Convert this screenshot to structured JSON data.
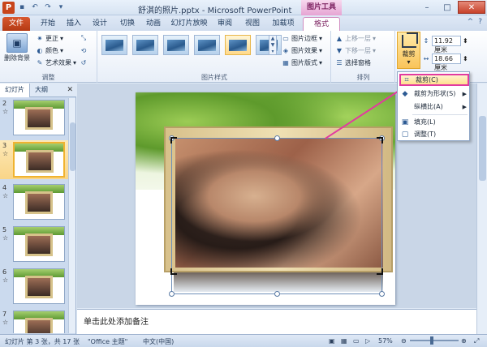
{
  "titlebar": {
    "title": "舒淇的照片.pptx - Microsoft PowerPoint",
    "context_group": "图片工具",
    "app_icon": "P",
    "qat": [
      "save-icon",
      "undo-icon",
      "redo-icon",
      "dropdown-icon"
    ],
    "controls": {
      "minimize": "–",
      "maximize": "□",
      "close": "✕"
    }
  },
  "tabs": {
    "file": "文件",
    "items": [
      "开始",
      "插入",
      "设计",
      "切换",
      "动画",
      "幻灯片放映",
      "审阅",
      "视图",
      "加载项"
    ],
    "format": "格式",
    "help_icon": "?",
    "ribbon_toggle": "^"
  },
  "ribbon": {
    "adjust": {
      "remove_bg": "删除背景",
      "corrections": "更正",
      "color": "颜色",
      "artistic": "艺术效果",
      "label": "调整"
    },
    "styles": {
      "label": "图片样式",
      "border": "图片边框",
      "effects": "图片效果",
      "layout": "图片版式"
    },
    "arrange": {
      "label": "排列",
      "bring_forward": "上移一层",
      "send_backward": "下移一层",
      "selection_pane": "选择窗格"
    },
    "size": {
      "crop": "裁剪",
      "height": "11.92 厘米",
      "width": "18.66 厘米"
    }
  },
  "crop_menu": {
    "items": [
      {
        "label": "裁剪(C)",
        "highlight": true,
        "icon": "crop-icon"
      },
      {
        "label": "裁剪为形状(S)",
        "submenu": true,
        "icon": "shape-icon"
      },
      {
        "label": "纵横比(A)",
        "submenu": true,
        "icon": ""
      },
      {
        "label": "填充(L)",
        "icon": "fill-icon"
      },
      {
        "label": "调整(T)",
        "icon": "fit-icon"
      }
    ]
  },
  "left_panel": {
    "tab_slides": "幻灯片",
    "tab_outline": "大纲",
    "close": "✕",
    "slides": [
      {
        "num": "2",
        "suffix": "☆"
      },
      {
        "num": "3",
        "suffix": "☆",
        "selected": true
      },
      {
        "num": "4",
        "suffix": "☆"
      },
      {
        "num": "5",
        "suffix": "☆"
      },
      {
        "num": "6",
        "suffix": "☆"
      },
      {
        "num": "7",
        "suffix": "☆"
      }
    ]
  },
  "notes": {
    "placeholder": "单击此处添加备注"
  },
  "status": {
    "slide_info": "幻灯片 第 3 张，共 17 张",
    "theme": "\"Office 主题\"",
    "language": "中文(中国)",
    "zoom": "57%"
  },
  "colors": {
    "accent_pink": "#e23aa0",
    "file_tab": "#c8451b",
    "highlight": "#f9c45a"
  }
}
